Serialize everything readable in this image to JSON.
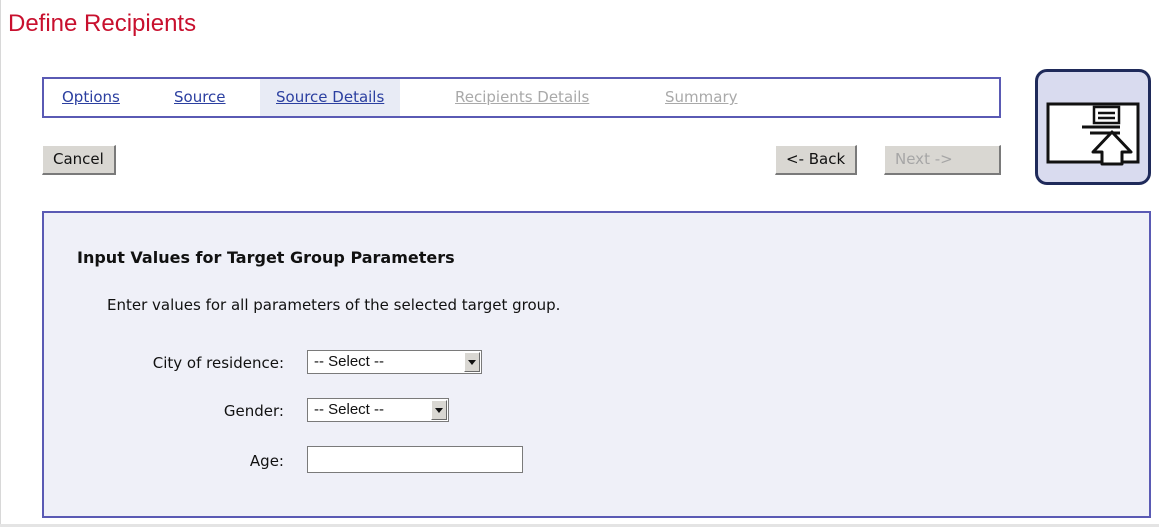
{
  "page": {
    "title": "Define Recipients"
  },
  "steps": [
    {
      "label": "Options",
      "state": "link"
    },
    {
      "label": "Source",
      "state": "link"
    },
    {
      "label": "Source Details",
      "state": "current"
    },
    {
      "label": "Recipients Details",
      "state": "disabled"
    },
    {
      "label": "Summary",
      "state": "disabled"
    }
  ],
  "buttons": {
    "cancel": "Cancel",
    "back": "<- Back",
    "next": "Next ->"
  },
  "wizard_icon": {
    "name": "monitor-upload-icon"
  },
  "form": {
    "heading": "Input Values for Target Group Parameters",
    "description": "Enter values for all parameters of the selected target group.",
    "fields": {
      "city": {
        "label": "City of residence:",
        "value": "-- Select --"
      },
      "gender": {
        "label": "Gender:",
        "value": "-- Select --"
      },
      "age": {
        "label": "Age:",
        "value": ""
      }
    }
  },
  "colors": {
    "title": "#c8102e",
    "link": "#2b3fa0",
    "frame_border": "#5a5ab4",
    "panel_bg": "#eff0f8",
    "disabled_text": "#a9a9a9"
  }
}
